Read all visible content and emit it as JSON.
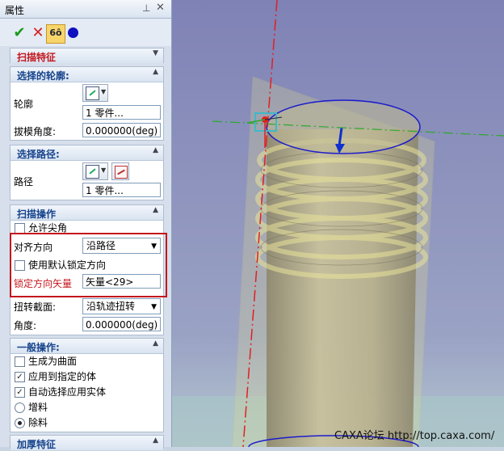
{
  "panel": {
    "title": "属性",
    "pin_icon": "pin-icon",
    "close_icon": "close-icon"
  },
  "toolbar": {
    "ok_icon": "check-icon",
    "cancel_icon": "cross-icon",
    "preview_label": "6ô",
    "dot_icon": "blue-dot-icon"
  },
  "feature": {
    "title": "扫描特征"
  },
  "profile_section": {
    "title": "选择的轮廓:",
    "profile_label": "轮廓",
    "profile_value": "1    零件...",
    "draft_label": "拔模角度:",
    "draft_value": "0.000000(deg)"
  },
  "path_section": {
    "title": "选择路径:",
    "path_label": "路径",
    "path_value": "1    零件..."
  },
  "sweep_section": {
    "title": "扫描操作",
    "allow_sharp_label": "允许尖角",
    "align_label": "对齐方向",
    "align_value": "沿路径",
    "use_default_lock_label": "使用默认锁定方向",
    "lock_vector_label": "锁定方向矢量",
    "lock_vector_value": "矢量<29>",
    "twist_label": "扭转截面:",
    "twist_value": "沿轨迹扭转",
    "angle_label": "角度:",
    "angle_value": "0.000000(deg)"
  },
  "general_section": {
    "title": "一般操作:",
    "gen_surface_label": "生成为曲面",
    "gen_surface_checked": false,
    "apply_body_label": "应用到指定的体",
    "apply_body_checked": true,
    "auto_select_label": "自动选择应用实体",
    "auto_select_checked": true,
    "add_label": "增料",
    "remove_label": "除料",
    "selected_mode": "除料"
  },
  "thicken_section": {
    "title": "加厚特征"
  },
  "viewport": {
    "watermark": "CAXA论坛 http://top.caxa.com/",
    "colors": {
      "background": "#8c8fbd",
      "body": "#b3ad8c",
      "ring": "#1c1ccc",
      "axis": "#e02020",
      "guide": "#2ea82e"
    }
  }
}
